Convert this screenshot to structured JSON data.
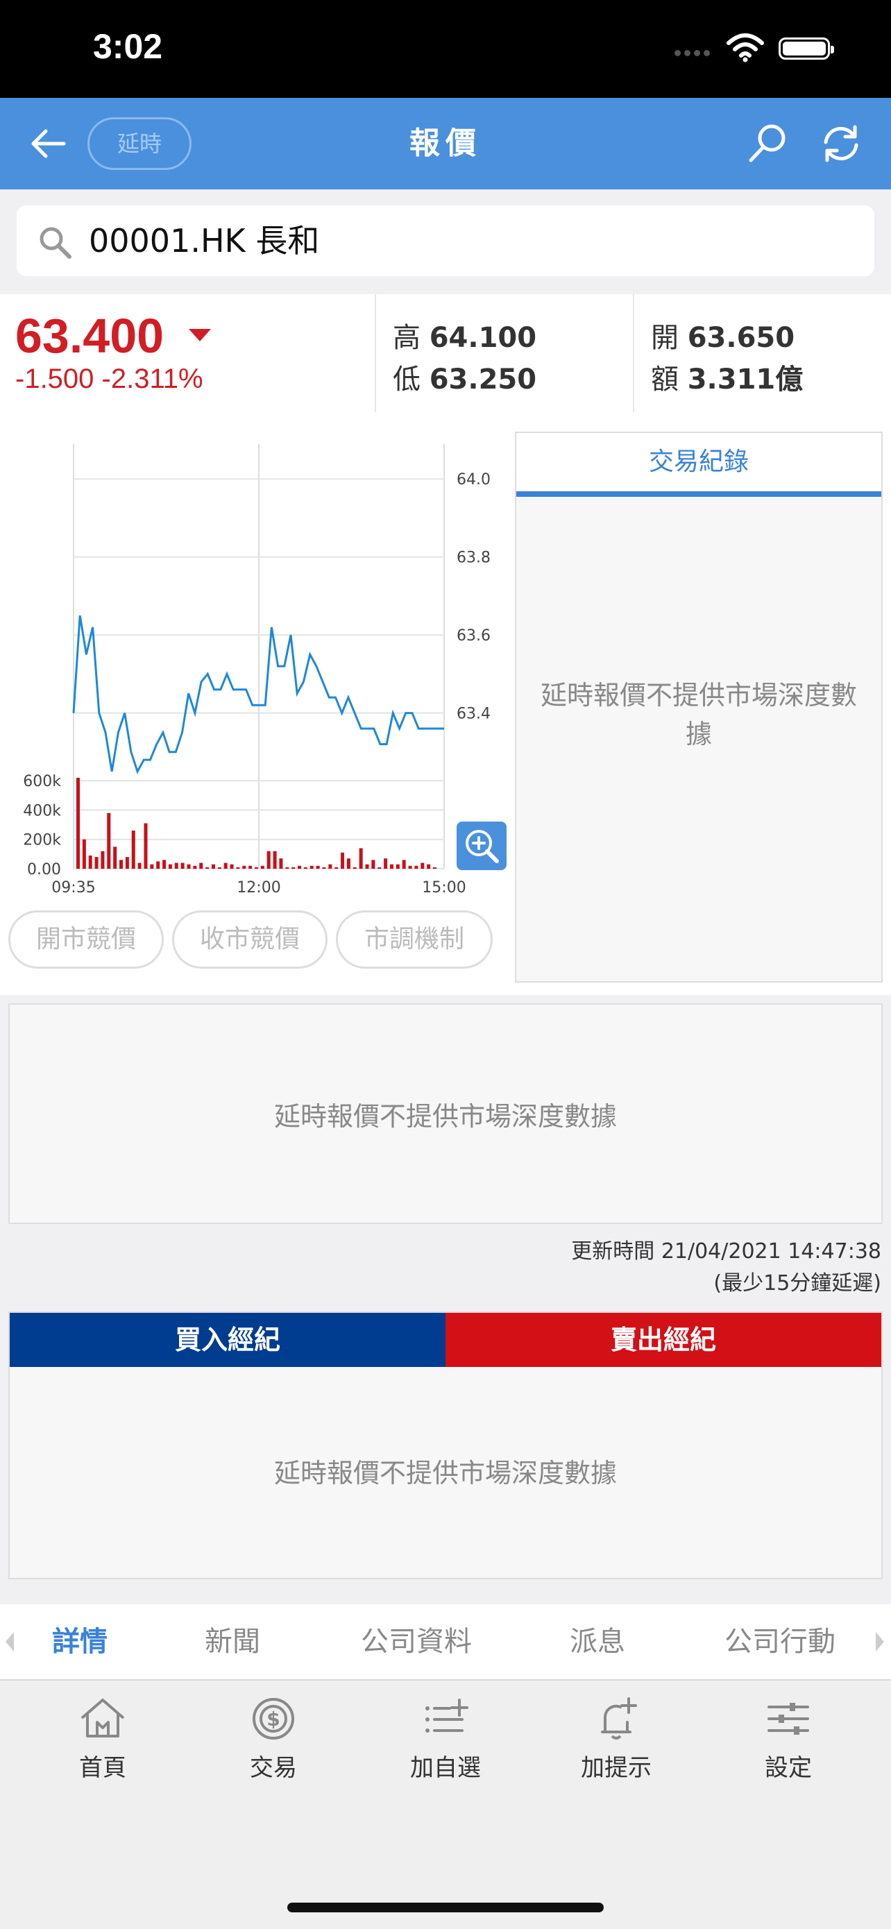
{
  "status_bar": {
    "time": "3:02"
  },
  "header": {
    "title": "報價",
    "delay_badge": "延時",
    "back_icon": "back-arrow-icon",
    "search_icon": "search-icon",
    "refresh_icon": "refresh-icon"
  },
  "search": {
    "value": "00001.HK 長和"
  },
  "quote": {
    "price": "63.400",
    "change": "-1.500 -2.311%",
    "high_label": "高",
    "high": "64.100",
    "low_label": "低",
    "low": "63.250",
    "open_label": "開",
    "open": "63.650",
    "turnover_label": "額",
    "turnover": "3.311億"
  },
  "colors": {
    "accent": "#4a90dc",
    "down": "#d01e24",
    "buy": "#003c8f",
    "sell": "#d21016",
    "line": "#1e88d6"
  },
  "chart_data": {
    "type": "line",
    "x_ticks": [
      "09:35",
      "12:00",
      "15:00"
    ],
    "y_ticks": [
      "64.0",
      "63.8",
      "63.6",
      "63.4"
    ],
    "ylim": [
      63.2,
      64.1
    ],
    "price": [
      63.4,
      63.65,
      63.55,
      63.62,
      63.4,
      63.35,
      63.25,
      63.35,
      63.4,
      63.3,
      63.25,
      63.28,
      63.28,
      63.32,
      63.35,
      63.3,
      63.3,
      63.35,
      63.45,
      63.4,
      63.48,
      63.5,
      63.46,
      63.46,
      63.5,
      63.46,
      63.46,
      63.46,
      63.42,
      63.42,
      63.42,
      63.62,
      63.52,
      63.52,
      63.6,
      63.45,
      63.48,
      63.55,
      63.52,
      63.48,
      63.44,
      63.44,
      63.4,
      63.44,
      63.4,
      63.36,
      63.36,
      63.36,
      63.32,
      63.32,
      63.4,
      63.36,
      63.4,
      63.4,
      63.36,
      63.36,
      63.36,
      63.36,
      63.36
    ],
    "volume_ticks": [
      "600k",
      "400k",
      "200k",
      "0.00"
    ],
    "volume_max": 700000,
    "volume": [
      620000,
      200000,
      90000,
      80000,
      120000,
      380000,
      150000,
      60000,
      80000,
      260000,
      40000,
      310000,
      30000,
      50000,
      60000,
      30000,
      40000,
      40000,
      30000,
      20000,
      40000,
      10000,
      30000,
      10000,
      40000,
      30000,
      10000,
      20000,
      20000,
      10000,
      20000,
      120000,
      120000,
      70000,
      10000,
      10000,
      20000,
      10000,
      20000,
      20000,
      10000,
      30000,
      10000,
      110000,
      70000,
      10000,
      140000,
      30000,
      60000,
      10000,
      70000,
      30000,
      30000,
      60000,
      20000,
      20000,
      40000,
      30000,
      10000
    ],
    "zoom_icon": "zoom-in-icon"
  },
  "auction_buttons": [
    "開市競價",
    "收市競價",
    "市調機制"
  ],
  "trade_panel": {
    "tab": "交易紀錄",
    "message": "延時報價不提供市場深度數據"
  },
  "depth": {
    "message": "延時報價不提供市場深度數據",
    "update_time": "更新時間 21/04/2021 14:47:38",
    "delay_note": "(最少15分鐘延遲)"
  },
  "brokers": {
    "buy_label": "買入經紀",
    "sell_label": "賣出經紀",
    "message": "延時報價不提供市場深度數據"
  },
  "sub_tabs": [
    "詳情",
    "新聞",
    "公司資料",
    "派息",
    "公司行動"
  ],
  "bottom_nav": [
    {
      "label": "首頁",
      "icon": "home-icon"
    },
    {
      "label": "交易",
      "icon": "dollar-exchange-icon"
    },
    {
      "label": "加自選",
      "icon": "add-list-icon"
    },
    {
      "label": "加提示",
      "icon": "add-alert-bell-icon"
    },
    {
      "label": "設定",
      "icon": "settings-sliders-icon"
    }
  ]
}
